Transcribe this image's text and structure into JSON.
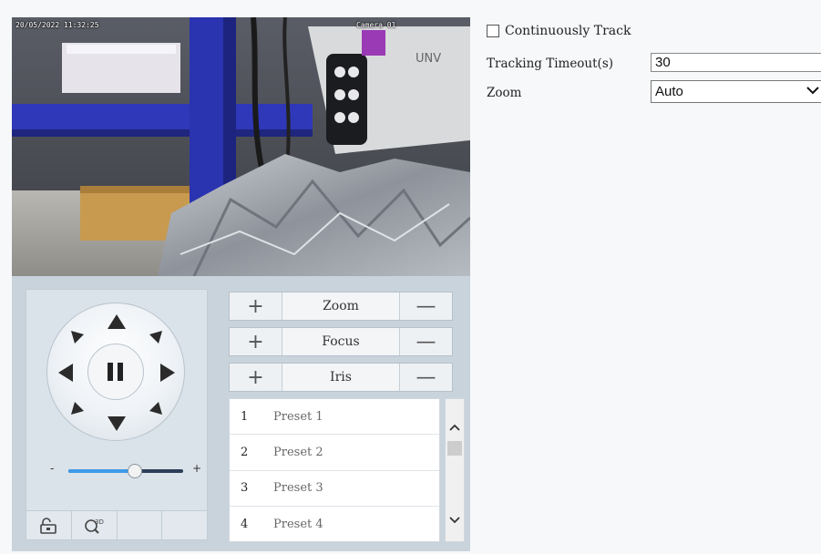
{
  "video": {
    "osd_timestamp": "20/05/2022 11:32:25",
    "osd_channel": "Camera 01",
    "camera_brand": "UNV"
  },
  "ptz": {
    "pause_icon": "pause-icon",
    "speed_minus": "-",
    "speed_plus": "+",
    "speed_level": 0.58,
    "tools": [
      "lock-icon",
      "3d-zoom-icon",
      "",
      ""
    ]
  },
  "lens": {
    "zoom_label": "Zoom",
    "focus_label": "Focus",
    "iris_label": "Iris",
    "plus": "+",
    "minus": "—"
  },
  "presets": [
    {
      "num": "1",
      "name": "Preset 1"
    },
    {
      "num": "2",
      "name": "Preset 2"
    },
    {
      "num": "3",
      "name": "Preset 3"
    },
    {
      "num": "4",
      "name": "Preset 4"
    }
  ],
  "settings": {
    "continuously_track_label": "Continuously Track",
    "continuously_track_checked": false,
    "tracking_timeout_label": "Tracking Timeout(s)",
    "tracking_timeout_value": "30",
    "zoom_label": "Zoom",
    "zoom_value": "Auto"
  },
  "colors": {
    "accent": "#3d9be9",
    "panel": "#c9d3dc"
  }
}
